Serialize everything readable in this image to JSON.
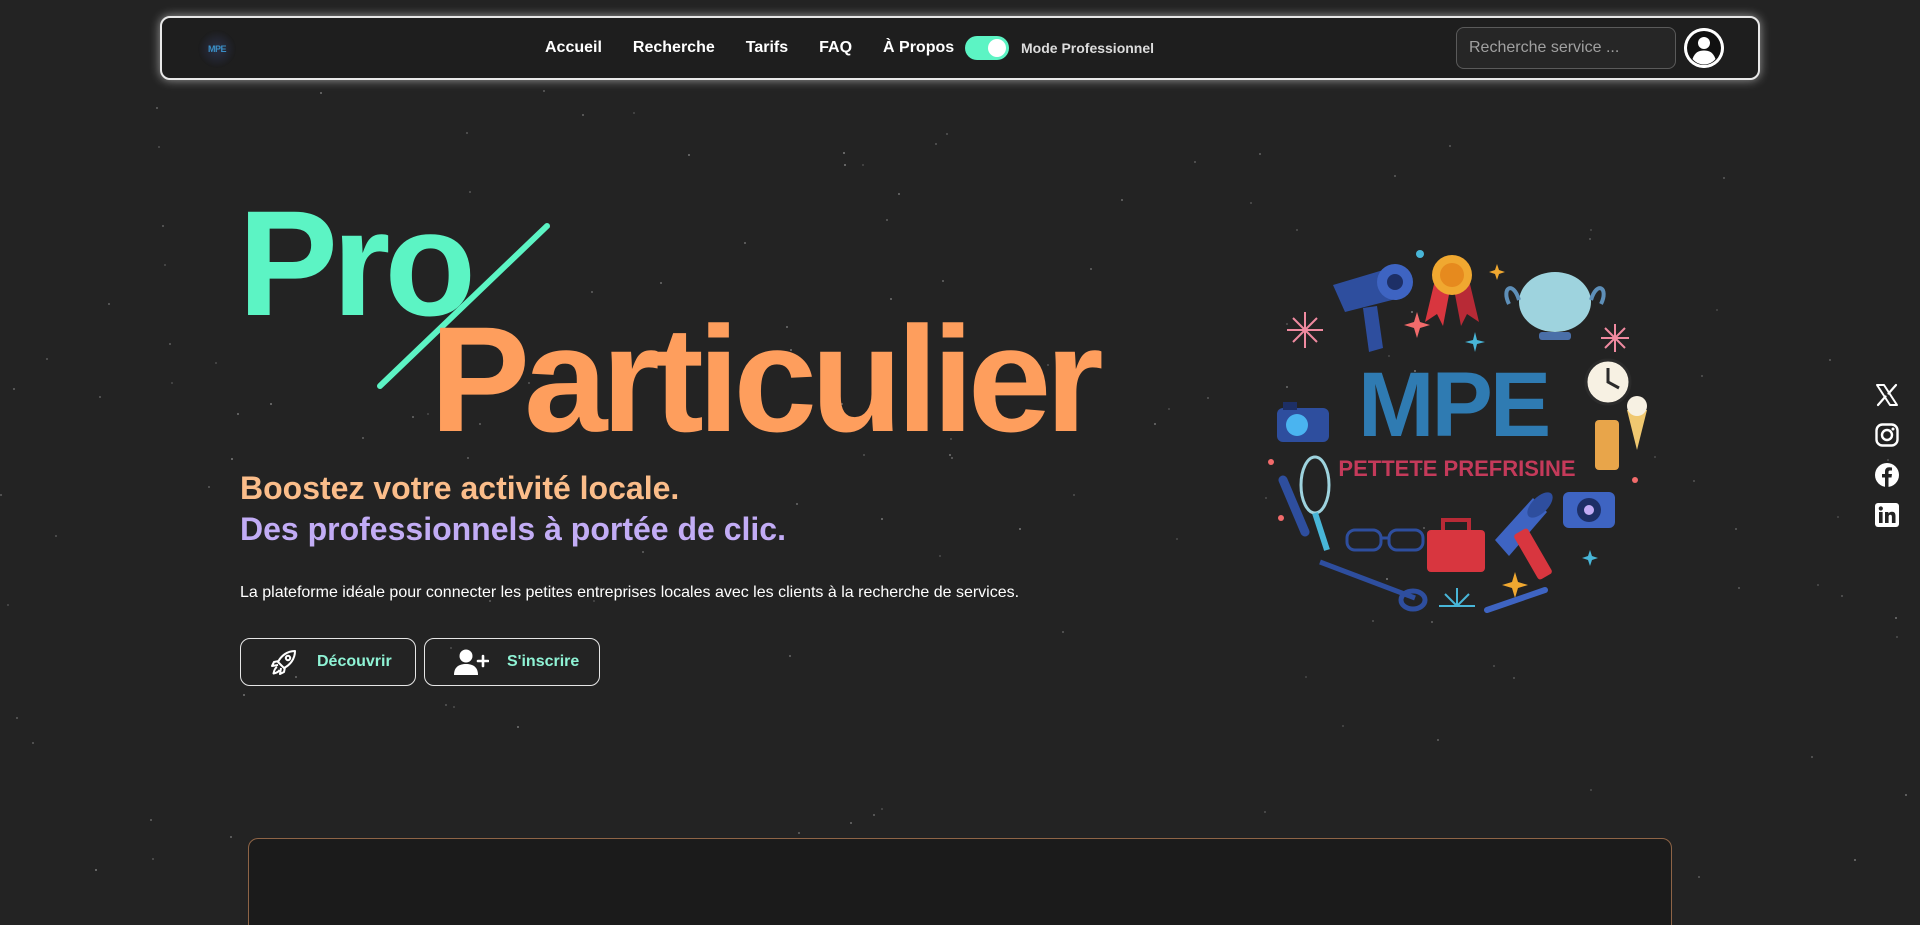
{
  "brand": {
    "logo_text": "MPE"
  },
  "nav": {
    "links": [
      "Accueil",
      "Recherche",
      "Tarifs",
      "FAQ",
      "À Propos"
    ],
    "mode_toggle": {
      "label": "Mode Professionnel",
      "enabled": true
    },
    "search_placeholder": "Recherche service ..."
  },
  "hero": {
    "title_part1": "Pro",
    "title_part2": "Particulier",
    "tagline_1": "Boostez votre activité locale.",
    "tagline_2": "Des professionnels à portée de clic.",
    "description": "La plateforme idéale pour connecter les petites entreprises locales avec les clients à la recherche de services.",
    "buttons": {
      "discover": "Découvrir",
      "signup": "S'inscrire"
    }
  },
  "illustration": {
    "title": "MPE",
    "subtitle": "PETTETE PREFRISINE"
  },
  "social": [
    "x-icon",
    "instagram-icon",
    "facebook-icon",
    "linkedin-icon"
  ],
  "colors": {
    "background": "#232323",
    "accent_green": "#5cf4c4",
    "accent_orange": "#fe9e5d",
    "tagline_orange": "#fbbd8a",
    "tagline_purple": "#c2acf5",
    "button_text": "#8ff3d5"
  }
}
